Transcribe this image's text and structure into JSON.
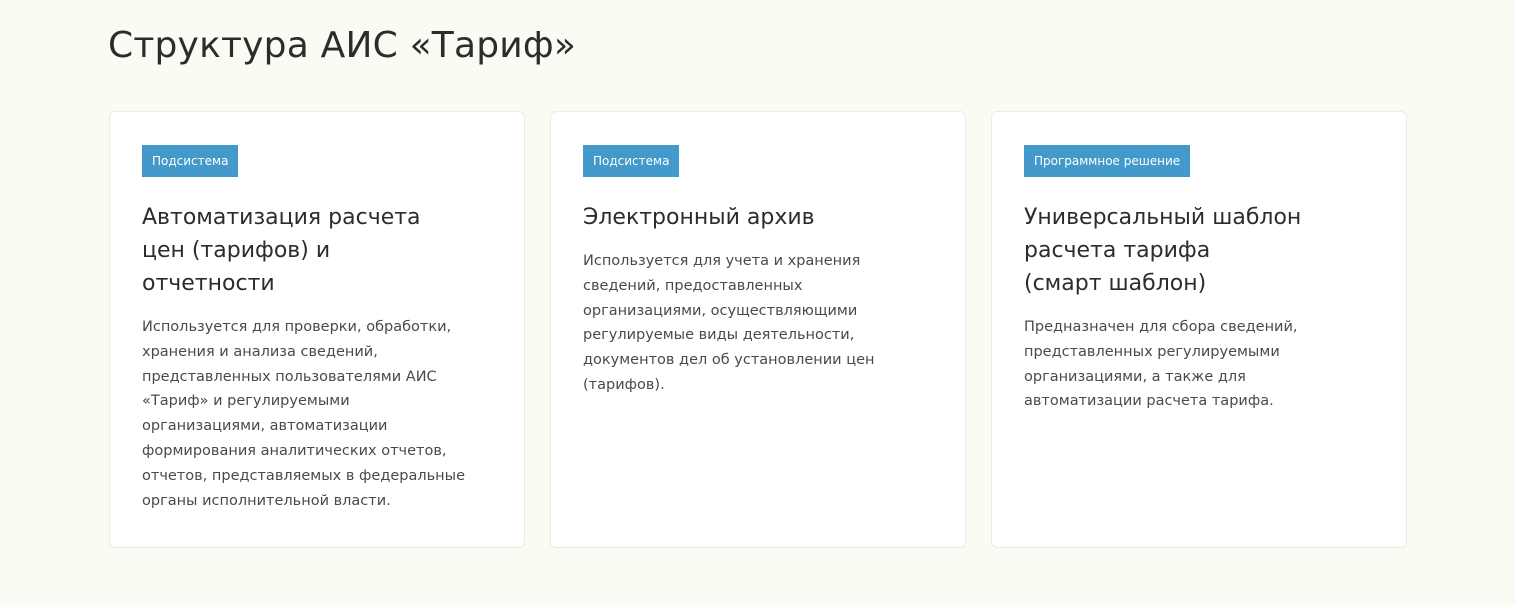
{
  "page": {
    "title": "Структура АИС «Тариф»"
  },
  "cards": [
    {
      "badge": "Подсистема",
      "title_lines": [
        "Автоматизация расчета",
        "цен (тарифов) и",
        "отчетности"
      ],
      "description_lines": [
        "Используется для проверки, обработки,",
        "хранения и анализа сведений,",
        "представленных пользователями АИС",
        "«Тариф» и регулируемыми",
        "организациями, автоматизации",
        "формирования аналитических отчетов,",
        "отчетов, представляемых в федеральные",
        "органы исполнительной власти."
      ]
    },
    {
      "badge": "Подсистема",
      "title_lines": [
        "Электронный архив"
      ],
      "description_lines": [
        "Используется для учета и хранения",
        "сведений, предоставленных",
        "организациями, осуществляющими",
        "регулируемые виды деятельности,",
        "документов дел об установлении цен",
        "(тарифов)."
      ]
    },
    {
      "badge": "Программное решение",
      "title_lines": [
        "Универсальный шаблон",
        "расчета тарифа",
        "(смарт шаблон)"
      ],
      "description_lines": [
        "Предназначен для сбора сведений,",
        "представленных регулируемыми",
        "организациями, а также для",
        "автоматизации расчета тарифа."
      ]
    }
  ],
  "colors": {
    "page_background": "#fbfaf3",
    "card_background": "#ffffff",
    "badge_background": "#4499cb",
    "badge_text": "#ffffff",
    "title_text": "#2c2c2c",
    "body_text": "#4a4a4a"
  }
}
